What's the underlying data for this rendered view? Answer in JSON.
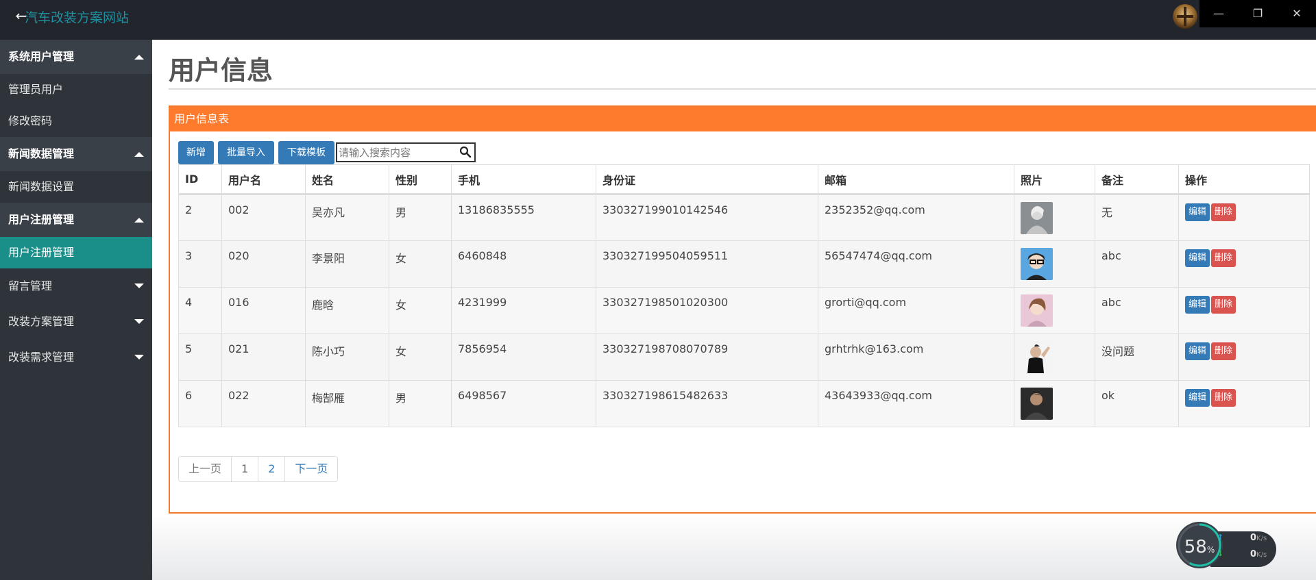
{
  "titlebar": {
    "title": "汽车改装方案网站",
    "back_icon": "←",
    "win_min": "—",
    "win_max": "❐",
    "win_close": "✕"
  },
  "sidebar": {
    "groups": [
      {
        "label": "系统用户管理",
        "expanded": true,
        "items": [
          "管理员用户",
          "修改密码"
        ]
      },
      {
        "label": "新闻数据管理",
        "expanded": true,
        "items": [
          "新闻数据设置"
        ]
      },
      {
        "label": "用户注册管理",
        "expanded": true,
        "items": [
          "用户注册管理"
        ]
      },
      {
        "label": "留言管理",
        "expanded": false,
        "items": []
      },
      {
        "label": "改装方案管理",
        "expanded": false,
        "items": []
      },
      {
        "label": "改装需求管理",
        "expanded": false,
        "items": []
      }
    ],
    "active_item": "用户注册管理"
  },
  "main": {
    "page_title": "用户信息",
    "panel_title": "用户信息表",
    "toolbar": {
      "add": "新增",
      "import": "批量导入",
      "template": "下载模板",
      "search_placeholder": "请输入搜索内容"
    },
    "table": {
      "headers": [
        "ID",
        "用户名",
        "姓名",
        "性别",
        "手机",
        "身份证",
        "邮箱",
        "照片",
        "备注",
        "操作"
      ],
      "rows": [
        {
          "id": "2",
          "username": "002",
          "name": "吴亦凡",
          "gender": "男",
          "phone": "13186835555",
          "idcard": "330327199010142546",
          "email": "2352352@qq.com",
          "remark": "无"
        },
        {
          "id": "3",
          "username": "020",
          "name": "李景阳",
          "gender": "女",
          "phone": "6460848",
          "idcard": "330327199504059511",
          "email": "56547474@qq.com",
          "remark": "abc"
        },
        {
          "id": "4",
          "username": "016",
          "name": "鹿晗",
          "gender": "女",
          "phone": "4231999",
          "idcard": "330327198501020300",
          "email": "grorti@qq.com",
          "remark": "abc"
        },
        {
          "id": "5",
          "username": "021",
          "name": "陈小巧",
          "gender": "女",
          "phone": "7856954",
          "idcard": "330327198708070789",
          "email": "grhtrhk@163.com",
          "remark": "没问题"
        },
        {
          "id": "6",
          "username": "022",
          "name": "梅郜雁",
          "gender": "男",
          "phone": "6498567",
          "idcard": "330327198615482633",
          "email": "43643933@qq.com",
          "remark": "ok"
        }
      ],
      "edit_label": "编辑",
      "delete_label": "删除"
    },
    "pager": {
      "prev": "上一页",
      "pages": [
        "1",
        "2"
      ],
      "next": "下一页"
    }
  },
  "net_widget": {
    "percent": "58",
    "percent_unit": "%",
    "up": "0",
    "down": "0",
    "unit": "K/s"
  },
  "colors": {
    "accent_orange": "#fe7a2d",
    "primary_blue": "#337ab7",
    "danger_red": "#d9534f",
    "active_teal": "#1a8f8a"
  }
}
